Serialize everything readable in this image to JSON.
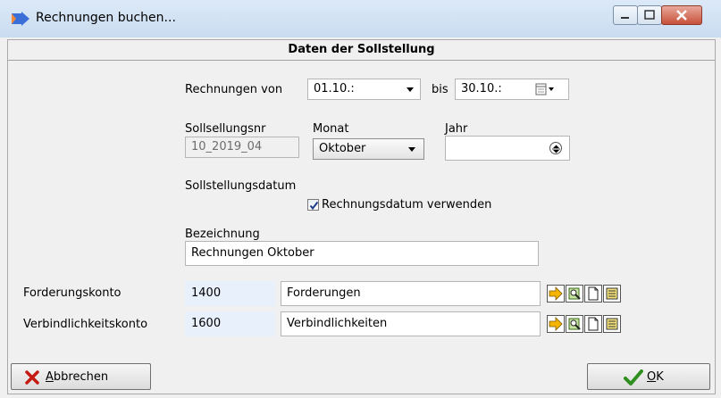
{
  "window": {
    "title": "Rechnungen buchen...",
    "controls": [
      "minimize",
      "maximize",
      "close"
    ]
  },
  "section": {
    "title": "Daten der Sollstellung"
  },
  "range": {
    "label_from": "Rechnungen von",
    "from_value": "01.10.:",
    "label_to": "bis",
    "to_value": "30.10.:"
  },
  "period": {
    "nr_label": "Sollsellungsnr",
    "nr_value": "10_2019_04",
    "month_label": "Monat",
    "month_value": "Oktober",
    "year_label": "Jahr",
    "year_value": ""
  },
  "date": {
    "label": "Sollstellungsdatum",
    "checkbox_label": "Rechnungsdatum verwenden",
    "checked": true
  },
  "description": {
    "label": "Bezeichnung",
    "value": "Rechnungen Oktober"
  },
  "accounts": [
    {
      "label": "Forderungskonto",
      "number": "1400",
      "name": "Forderungen"
    },
    {
      "label": "Verbindlichkeitskonto",
      "number": "1600",
      "name": "Verbindlichkeiten"
    }
  ],
  "buttons": {
    "cancel_hotkey": "A",
    "cancel_rest": "bbrechen",
    "ok_hotkey": "O",
    "ok_rest": "K"
  }
}
